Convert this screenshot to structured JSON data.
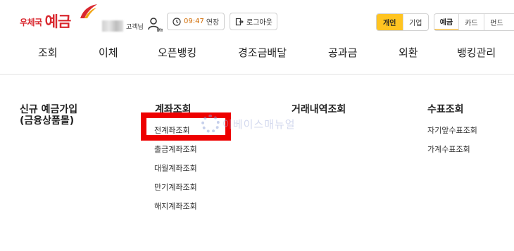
{
  "brand": {
    "logo_small": "우체국",
    "logo_big": "예금",
    "colors": {
      "brand_red": "#d9282f",
      "accent_yellow": "#ffc421"
    }
  },
  "user": {
    "name_suffix": "고객님",
    "icon": "user-my-icon"
  },
  "session": {
    "time": "09:47",
    "extend_label": "연장",
    "logout_label": "로그아웃"
  },
  "segments": {
    "customer_type": [
      "개인",
      "기업"
    ],
    "customer_type_selected": "개인",
    "service_type": [
      "예금",
      "카드",
      "펀드"
    ],
    "service_type_selected": "예금"
  },
  "nav": {
    "items": [
      "조회",
      "이체",
      "오픈뱅킹",
      "경조금배달",
      "공과금",
      "외환",
      "뱅킹관리"
    ]
  },
  "menu": {
    "col1": {
      "title_line1": "신규 예금가입",
      "title_line2": "(금융상품몰)"
    },
    "col2": {
      "title": "계좌조회",
      "links": [
        "전계좌조회",
        "출금계좌조회",
        "대월계좌조회",
        "만기계좌조회",
        "해지계좌조회"
      ]
    },
    "col3": {
      "title": "거래내역조회"
    },
    "col4": {
      "title": "수표조회",
      "links": [
        "자기앞수표조회",
        "가계수표조회"
      ]
    }
  },
  "watermark": {
    "text": "이베이스매뉴얼"
  }
}
